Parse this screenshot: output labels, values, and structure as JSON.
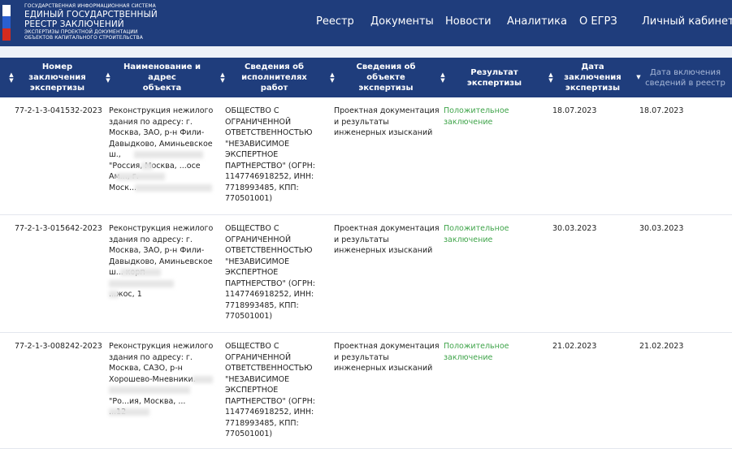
{
  "header": {
    "logo_sup": "ГОСУДАРСТВЕННАЯ ИНФОРМАЦИОННАЯ СИСТЕМА",
    "logo_line1": "ЕДИНЫЙ ГОСУДАРСТВЕННЫЙ",
    "logo_line2": "РЕЕСТР ЗАКЛЮЧЕНИЙ",
    "logo_sub1": "ЭКСПЕРТИЗЫ ПРОЕКТНОЙ ДОКУМЕНТАЦИИ",
    "logo_sub2": "ОБЪЕКТОВ КАПИТАЛЬНОГО СТРОИТЕЛЬСТВА",
    "nav": [
      "Реестр",
      "Документы",
      "Новости",
      "Аналитика",
      "О ЕГРЗ",
      "Личный кабинет"
    ]
  },
  "colors": {
    "brand": "#1f3d7c",
    "positive": "#3fa44a"
  },
  "table": {
    "columns": [
      [
        "Номер заключения",
        "экспертизы"
      ],
      [
        "Наименование и адрес",
        "объекта"
      ],
      [
        "Сведения об",
        "исполнителях работ"
      ],
      [
        "Сведения об объекте",
        "экспертизы"
      ],
      [
        "Результат экспертизы",
        ""
      ],
      [
        "Дата заключения",
        "экспертизы"
      ],
      [
        "Дата включения",
        "сведений в реестр"
      ]
    ],
    "rows": [
      {
        "number": "77-2-1-3-041532-2023",
        "name": [
          "Реконструкция нежилого",
          "здания по адресу: г.",
          "Москва, ЗАО, р-н Фили-",
          "Давыдково, Аминьевское",
          "ш., ",
          "\"Россия, Москва, ...осе",
          "Ам...,  г.",
          "Моск... "
        ],
        "executor": [
          "ОБЩЕСТВО С",
          "ОГРАНИЧЕННОЙ",
          "ОТВЕТСТВЕННОСТЬЮ",
          "\"НЕЗАВИСИМОЕ",
          "ЭКСПЕРТНОЕ",
          "ПАРТНЕРСТВО\" (ОГРН:",
          "1147746918252, ИНН:",
          "7718993485, КПП:",
          "770501001)"
        ],
        "object": [
          "Проектная документация",
          "и результаты",
          "инженерных изысканий"
        ],
        "result": [
          "Положительное",
          "заключение"
        ],
        "date_concl": "18.07.2023",
        "date_incl": "18.07.2023"
      },
      {
        "number": "77-2-1-3-015642-2023",
        "name": [
          "Реконструкция нежилого",
          "здания по адресу: г.",
          "Москва, ЗАО, р-н Фили-",
          "Давыдково, Аминьевское",
          "ш... корп",
          "",
          "...жос, 1"
        ],
        "executor": [
          "ОБЩЕСТВО С",
          "ОГРАНИЧЕННОЙ",
          "ОТВЕТСТВЕННОСТЬЮ",
          "\"НЕЗАВИСИМОЕ",
          "ЭКСПЕРТНОЕ",
          "ПАРТНЕРСТВО\" (ОГРН:",
          "1147746918252, ИНН:",
          "7718993485, КПП:",
          "770501001)"
        ],
        "object": [
          "Проектная документация",
          "и результаты",
          "инженерных изысканий"
        ],
        "result": [
          "Положительное",
          "заключение"
        ],
        "date_concl": "30.03.2023",
        "date_incl": "30.03.2023"
      },
      {
        "number": "77-2-1-3-008242-2023",
        "name": [
          "Реконструкция нежилого",
          "здания по адресу: г.",
          "Москва, САЗО, р-н",
          "Хорошево-Мневники. ",
          "",
          "\"Ро...ия, Москва, ...",
          "...12"
        ],
        "executor": [
          "ОБЩЕСТВО С",
          "ОГРАНИЧЕННОЙ",
          "ОТВЕТСТВЕННОСТЬЮ",
          "\"НЕЗАВИСИМОЕ",
          "ЭКСПЕРТНОЕ",
          "ПАРТНЕРСТВО\" (ОГРН:",
          "1147746918252, ИНН:",
          "7718993485, КПП:",
          "770501001)"
        ],
        "object": [
          "Проектная документация",
          "и результаты",
          "инженерных изысканий"
        ],
        "result": [
          "Положительное",
          "заключение"
        ],
        "date_concl": "21.02.2023",
        "date_incl": "21.02.2023"
      }
    ]
  }
}
